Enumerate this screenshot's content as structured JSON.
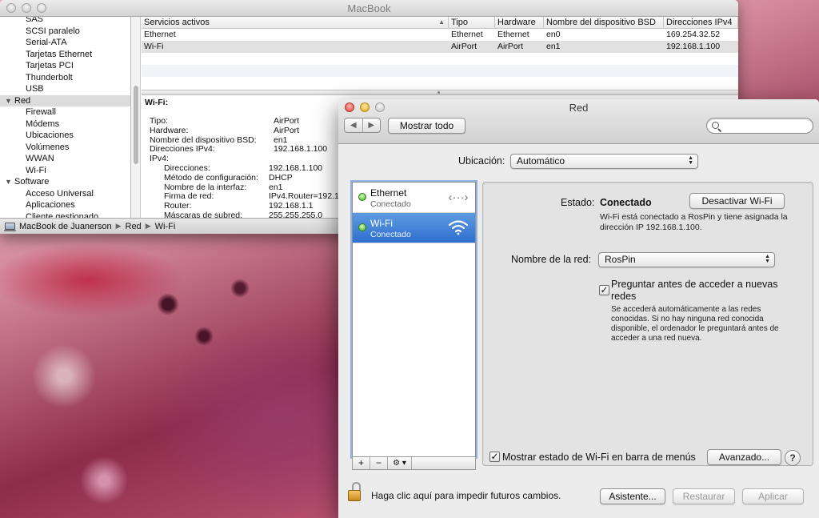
{
  "profiler": {
    "title": "MacBook",
    "sidebar": [
      {
        "label": "SAS",
        "group": false,
        "selected": false
      },
      {
        "label": "SCSI paralelo",
        "group": false,
        "selected": false
      },
      {
        "label": "Serial-ATA",
        "group": false,
        "selected": false
      },
      {
        "label": "Tarjetas Ethernet",
        "group": false,
        "selected": false
      },
      {
        "label": "Tarjetas PCI",
        "group": false,
        "selected": false
      },
      {
        "label": "Thunderbolt",
        "group": false,
        "selected": false
      },
      {
        "label": "USB",
        "group": false,
        "selected": false
      },
      {
        "label": "Red",
        "group": true,
        "selected": true
      },
      {
        "label": "Firewall",
        "group": false,
        "selected": false
      },
      {
        "label": "Módems",
        "group": false,
        "selected": false
      },
      {
        "label": "Ubicaciones",
        "group": false,
        "selected": false
      },
      {
        "label": "Volúmenes",
        "group": false,
        "selected": false
      },
      {
        "label": "WWAN",
        "group": false,
        "selected": false
      },
      {
        "label": "Wi-Fi",
        "group": false,
        "selected": false
      },
      {
        "label": "Software",
        "group": true,
        "selected": false
      },
      {
        "label": "Acceso Universal",
        "group": false,
        "selected": false
      },
      {
        "label": "Aplicaciones",
        "group": false,
        "selected": false
      },
      {
        "label": "Cliente gestionado",
        "group": false,
        "selected": false
      }
    ],
    "table": {
      "headers": [
        "Servicios activos",
        "Tipo",
        "Hardware",
        "Nombre del dispositivo BSD",
        "Direcciones IPv4"
      ],
      "rows": [
        [
          "Ethernet",
          "Ethernet",
          "Ethernet",
          "en0",
          "169.254.32.52"
        ],
        [
          "Wi-Fi",
          "AirPort",
          "AirPort",
          "en1",
          "192.168.1.100"
        ]
      ]
    },
    "detail": {
      "heading": "Wi-Fi:",
      "lines": [
        {
          "label": "Tipo:",
          "value": "AirPort",
          "indent": 0
        },
        {
          "label": "Hardware:",
          "value": "AirPort",
          "indent": 0
        },
        {
          "label": "Nombre del dispositivo BSD:",
          "value": "en1",
          "indent": 0
        },
        {
          "label": "Direcciones IPv4:",
          "value": "192.168.1.100",
          "indent": 0
        },
        {
          "label": "IPv4:",
          "value": "",
          "indent": 0
        },
        {
          "label": "Direcciones:",
          "value": "192.168.1.100",
          "indent": 1
        },
        {
          "label": "Método de configuración:",
          "value": "DHCP",
          "indent": 1
        },
        {
          "label": "Nombre de la interfaz:",
          "value": "en1",
          "indent": 1
        },
        {
          "label": "Firma de red:",
          "value": "IPv4.Router=192.1",
          "indent": 1
        },
        {
          "label": "Router:",
          "value": "192.168.1.1",
          "indent": 1
        },
        {
          "label": "Máscaras de subred:",
          "value": "255.255.255.0",
          "indent": 1
        }
      ]
    },
    "breadcrumb": [
      "MacBook de Juanerson",
      "Red",
      "Wi-Fi"
    ]
  },
  "network": {
    "title": "Red",
    "show_all": "Mostrar todo",
    "search_placeholder": "",
    "location_label": "Ubicación:",
    "location_value": "Automático",
    "services": [
      {
        "name": "Ethernet",
        "status": "Conectado",
        "icon": "ethernet-arrows-icon",
        "selected": false
      },
      {
        "name": "Wi-Fi",
        "status": "Conectado",
        "icon": "wifi-icon",
        "selected": true
      }
    ],
    "state_label": "Estado:",
    "state_value": "Conectado",
    "turn_off_button": "Desactivar Wi-Fi",
    "state_description": "Wi-Fi está conectado a RosPin y tiene asignada la dirección IP 192.168.1.100.",
    "network_name_label": "Nombre de la red:",
    "network_name_value": "RosPin",
    "ask_join_label": "Preguntar antes de acceder a nuevas redes",
    "ask_join_checked": true,
    "ask_join_description": "Se accederá automáticamente a las redes conocidas. Si no hay ninguna red conocida disponible, el ordenador le preguntará antes de acceder a una red nueva.",
    "show_menu_label": "Mostrar estado de Wi-Fi en barra de menús",
    "show_menu_checked": true,
    "advanced_button": "Avanzado...",
    "help_label": "?",
    "lock_text": "Haga clic aquí para impedir futuros cambios.",
    "assistant_button": "Asistente...",
    "revert_button": "Restaurar",
    "apply_button": "Aplicar",
    "list_controls": {
      "add": "+",
      "remove": "−",
      "gear": "⚙ ▾"
    }
  },
  "colors": {
    "selection_blue": "#2f6fcf",
    "status_green": "#3fae1e",
    "focus_ring": "#8fb3de"
  }
}
